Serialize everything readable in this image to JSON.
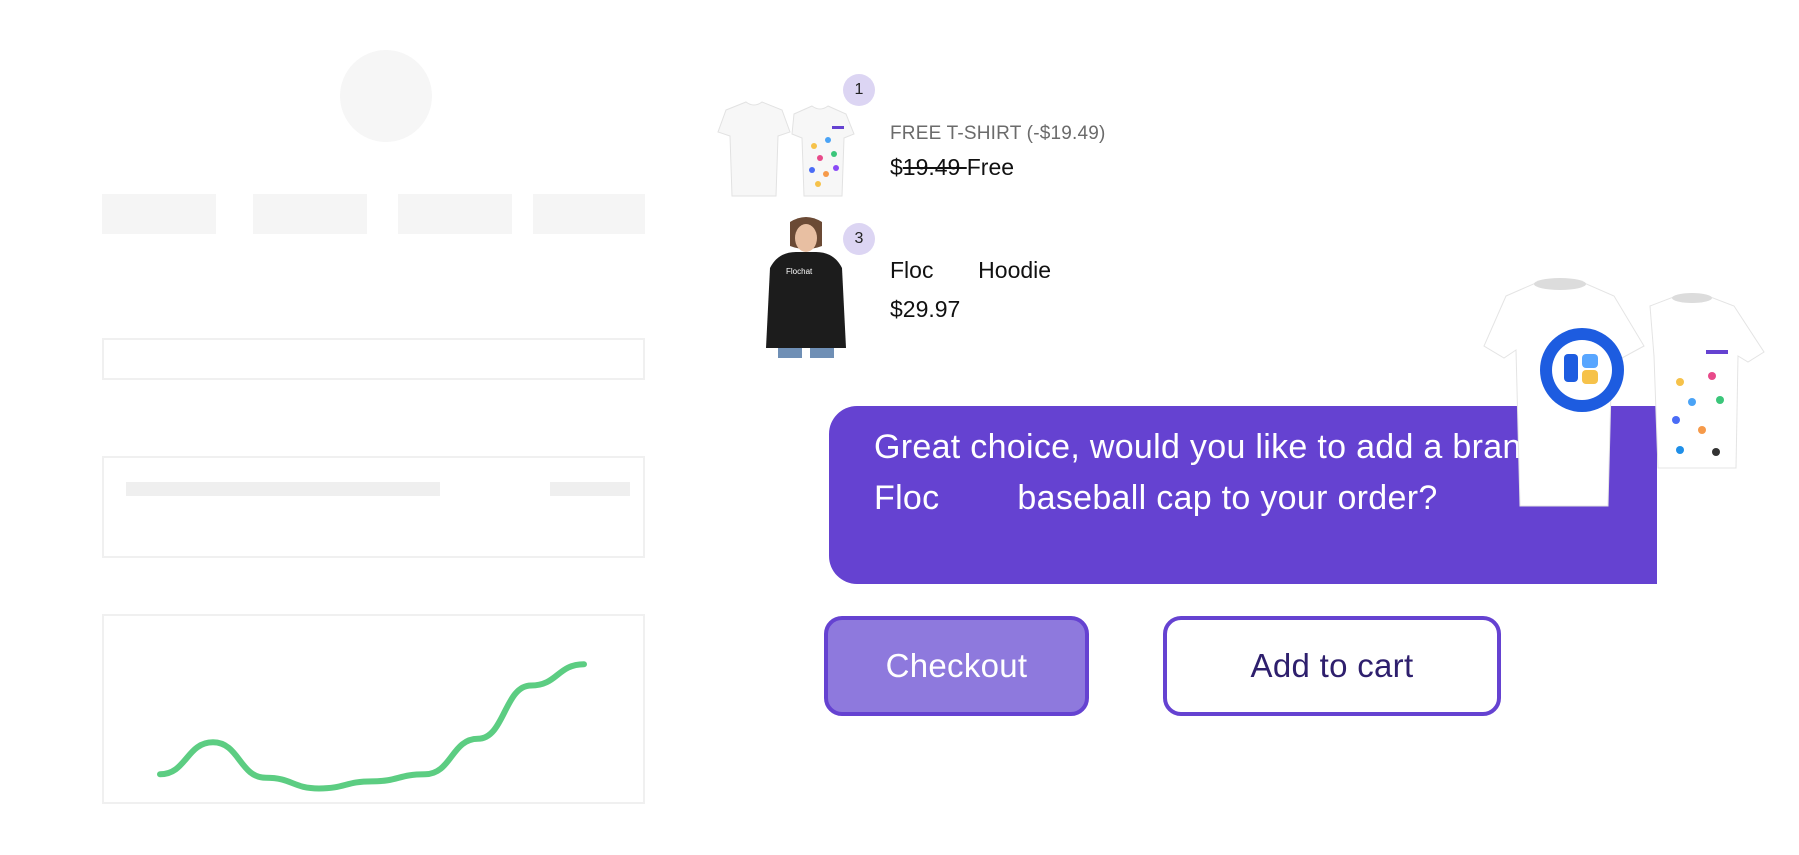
{
  "cart": {
    "items": [
      {
        "badge": "1",
        "subtitle": "FREE T-SHIRT (-$19.49)",
        "price_currency": "$",
        "price_original": "19.49 ",
        "price_final": "Free"
      },
      {
        "badge": "3",
        "name": "Floc       Hoodie",
        "price": "$29.97"
      }
    ]
  },
  "chat": {
    "message": "Great choice, would you like to add a branded Floc        baseball cap to your order?",
    "buttons": {
      "checkout": "Checkout",
      "add_to_cart": "Add to cart"
    }
  },
  "icons": {
    "logo": "flochat-logo-icon",
    "hoodie_print": "Flochat"
  },
  "colors": {
    "accent": "#6542d1",
    "accent_light": "#8e79dd",
    "badge_bg": "#dcd5f3",
    "chart_line": "#5ccd82"
  },
  "chart_data": {
    "type": "line",
    "title": "",
    "xlabel": "",
    "ylabel": "",
    "x": [
      0,
      1,
      2,
      3,
      4,
      5,
      6,
      7,
      8
    ],
    "values": [
      10,
      28,
      8,
      2,
      6,
      10,
      30,
      60,
      72
    ],
    "ylim": [
      0,
      80
    ],
    "grid": false
  }
}
